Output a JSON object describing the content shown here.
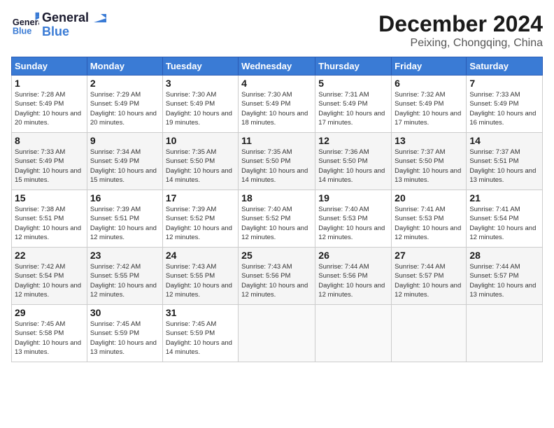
{
  "header": {
    "logo_general": "General",
    "logo_blue": "Blue",
    "month_title": "December 2024",
    "subtitle": "Peixing, Chongqing, China"
  },
  "calendar": {
    "days_of_week": [
      "Sunday",
      "Monday",
      "Tuesday",
      "Wednesday",
      "Thursday",
      "Friday",
      "Saturday"
    ],
    "weeks": [
      [
        null,
        {
          "day": "2",
          "sunrise": "Sunrise: 7:29 AM",
          "sunset": "Sunset: 5:49 PM",
          "daylight": "Daylight: 10 hours and 20 minutes."
        },
        {
          "day": "3",
          "sunrise": "Sunrise: 7:30 AM",
          "sunset": "Sunset: 5:49 PM",
          "daylight": "Daylight: 10 hours and 19 minutes."
        },
        {
          "day": "4",
          "sunrise": "Sunrise: 7:30 AM",
          "sunset": "Sunset: 5:49 PM",
          "daylight": "Daylight: 10 hours and 18 minutes."
        },
        {
          "day": "5",
          "sunrise": "Sunrise: 7:31 AM",
          "sunset": "Sunset: 5:49 PM",
          "daylight": "Daylight: 10 hours and 17 minutes."
        },
        {
          "day": "6",
          "sunrise": "Sunrise: 7:32 AM",
          "sunset": "Sunset: 5:49 PM",
          "daylight": "Daylight: 10 hours and 17 minutes."
        },
        {
          "day": "7",
          "sunrise": "Sunrise: 7:33 AM",
          "sunset": "Sunset: 5:49 PM",
          "daylight": "Daylight: 10 hours and 16 minutes."
        }
      ],
      [
        {
          "day": "8",
          "sunrise": "Sunrise: 7:33 AM",
          "sunset": "Sunset: 5:49 PM",
          "daylight": "Daylight: 10 hours and 15 minutes."
        },
        {
          "day": "9",
          "sunrise": "Sunrise: 7:34 AM",
          "sunset": "Sunset: 5:49 PM",
          "daylight": "Daylight: 10 hours and 15 minutes."
        },
        {
          "day": "10",
          "sunrise": "Sunrise: 7:35 AM",
          "sunset": "Sunset: 5:50 PM",
          "daylight": "Daylight: 10 hours and 14 minutes."
        },
        {
          "day": "11",
          "sunrise": "Sunrise: 7:35 AM",
          "sunset": "Sunset: 5:50 PM",
          "daylight": "Daylight: 10 hours and 14 minutes."
        },
        {
          "day": "12",
          "sunrise": "Sunrise: 7:36 AM",
          "sunset": "Sunset: 5:50 PM",
          "daylight": "Daylight: 10 hours and 14 minutes."
        },
        {
          "day": "13",
          "sunrise": "Sunrise: 7:37 AM",
          "sunset": "Sunset: 5:50 PM",
          "daylight": "Daylight: 10 hours and 13 minutes."
        },
        {
          "day": "14",
          "sunrise": "Sunrise: 7:37 AM",
          "sunset": "Sunset: 5:51 PM",
          "daylight": "Daylight: 10 hours and 13 minutes."
        }
      ],
      [
        {
          "day": "15",
          "sunrise": "Sunrise: 7:38 AM",
          "sunset": "Sunset: 5:51 PM",
          "daylight": "Daylight: 10 hours and 12 minutes."
        },
        {
          "day": "16",
          "sunrise": "Sunrise: 7:39 AM",
          "sunset": "Sunset: 5:51 PM",
          "daylight": "Daylight: 10 hours and 12 minutes."
        },
        {
          "day": "17",
          "sunrise": "Sunrise: 7:39 AM",
          "sunset": "Sunset: 5:52 PM",
          "daylight": "Daylight: 10 hours and 12 minutes."
        },
        {
          "day": "18",
          "sunrise": "Sunrise: 7:40 AM",
          "sunset": "Sunset: 5:52 PM",
          "daylight": "Daylight: 10 hours and 12 minutes."
        },
        {
          "day": "19",
          "sunrise": "Sunrise: 7:40 AM",
          "sunset": "Sunset: 5:53 PM",
          "daylight": "Daylight: 10 hours and 12 minutes."
        },
        {
          "day": "20",
          "sunrise": "Sunrise: 7:41 AM",
          "sunset": "Sunset: 5:53 PM",
          "daylight": "Daylight: 10 hours and 12 minutes."
        },
        {
          "day": "21",
          "sunrise": "Sunrise: 7:41 AM",
          "sunset": "Sunset: 5:54 PM",
          "daylight": "Daylight: 10 hours and 12 minutes."
        }
      ],
      [
        {
          "day": "22",
          "sunrise": "Sunrise: 7:42 AM",
          "sunset": "Sunset: 5:54 PM",
          "daylight": "Daylight: 10 hours and 12 minutes."
        },
        {
          "day": "23",
          "sunrise": "Sunrise: 7:42 AM",
          "sunset": "Sunset: 5:55 PM",
          "daylight": "Daylight: 10 hours and 12 minutes."
        },
        {
          "day": "24",
          "sunrise": "Sunrise: 7:43 AM",
          "sunset": "Sunset: 5:55 PM",
          "daylight": "Daylight: 10 hours and 12 minutes."
        },
        {
          "day": "25",
          "sunrise": "Sunrise: 7:43 AM",
          "sunset": "Sunset: 5:56 PM",
          "daylight": "Daylight: 10 hours and 12 minutes."
        },
        {
          "day": "26",
          "sunrise": "Sunrise: 7:44 AM",
          "sunset": "Sunset: 5:56 PM",
          "daylight": "Daylight: 10 hours and 12 minutes."
        },
        {
          "day": "27",
          "sunrise": "Sunrise: 7:44 AM",
          "sunset": "Sunset: 5:57 PM",
          "daylight": "Daylight: 10 hours and 12 minutes."
        },
        {
          "day": "28",
          "sunrise": "Sunrise: 7:44 AM",
          "sunset": "Sunset: 5:57 PM",
          "daylight": "Daylight: 10 hours and 13 minutes."
        }
      ],
      [
        {
          "day": "29",
          "sunrise": "Sunrise: 7:45 AM",
          "sunset": "Sunset: 5:58 PM",
          "daylight": "Daylight: 10 hours and 13 minutes."
        },
        {
          "day": "30",
          "sunrise": "Sunrise: 7:45 AM",
          "sunset": "Sunset: 5:59 PM",
          "daylight": "Daylight: 10 hours and 13 minutes."
        },
        {
          "day": "31",
          "sunrise": "Sunrise: 7:45 AM",
          "sunset": "Sunset: 5:59 PM",
          "daylight": "Daylight: 10 hours and 14 minutes."
        },
        null,
        null,
        null,
        null
      ]
    ],
    "week1_day1": {
      "day": "1",
      "sunrise": "Sunrise: 7:28 AM",
      "sunset": "Sunset: 5:49 PM",
      "daylight": "Daylight: 10 hours and 20 minutes."
    }
  }
}
